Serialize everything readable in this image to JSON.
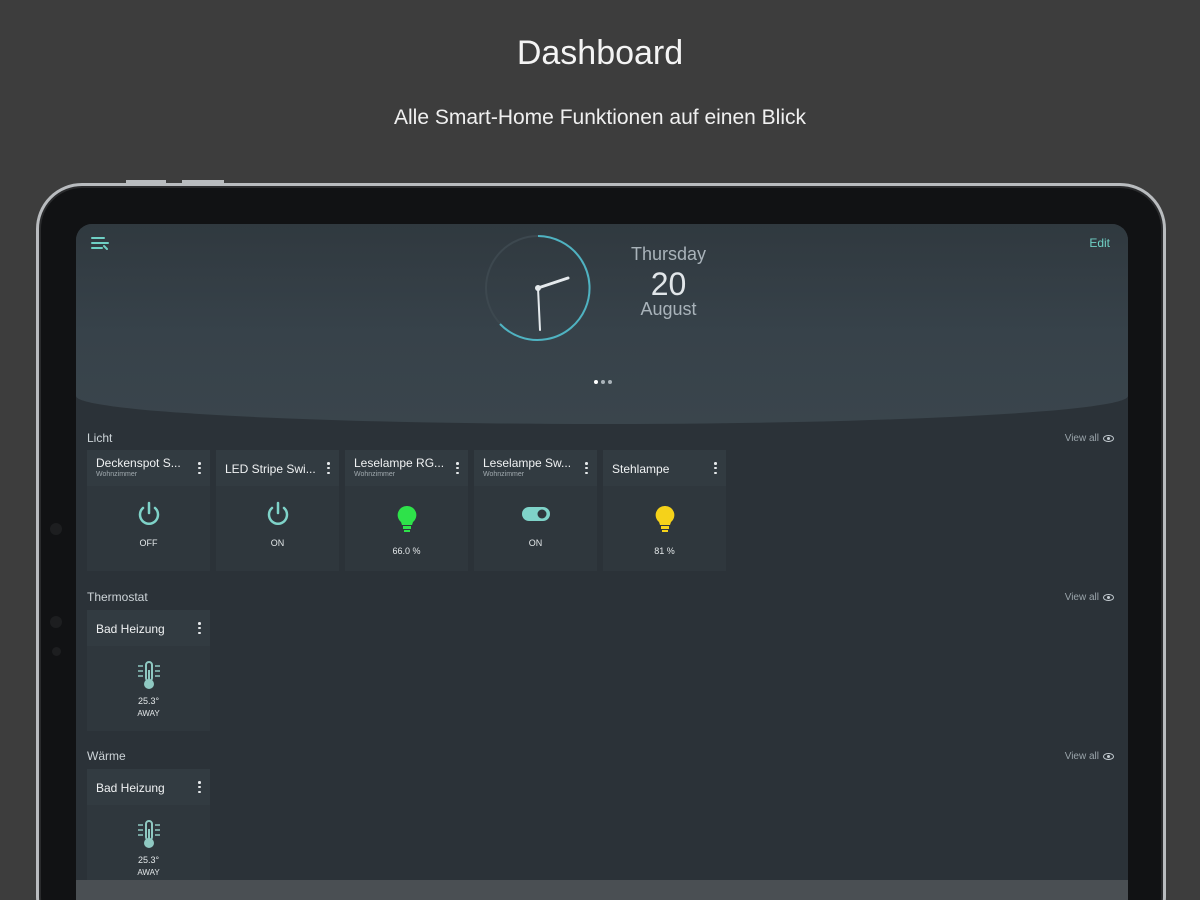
{
  "promo": {
    "title": "Dashboard",
    "subtitle": "Alle Smart-Home Funktionen auf einen Blick"
  },
  "header": {
    "edit_label": "Edit",
    "day": "Thursday",
    "date": "20",
    "month": "August"
  },
  "sections": [
    {
      "title": "Licht",
      "view_all": "View all",
      "cards": [
        {
          "name": "Deckenspot S...",
          "room": "Wohnzimmer",
          "value": "OFF",
          "icon": "power-icon",
          "color": "#7fd3c9"
        },
        {
          "name": "LED Stripe Swi...",
          "room": "",
          "value": "ON",
          "icon": "power-icon",
          "color": "#7fd3c9"
        },
        {
          "name": "Leselampe RG...",
          "room": "Wohnzimmer",
          "value": "66.0 %",
          "icon": "bulb-icon",
          "color": "#2ee24a"
        },
        {
          "name": "Leselampe Sw...",
          "room": "Wohnzimmer",
          "value": "ON",
          "icon": "toggle-icon",
          "color": "#7fd3c9"
        },
        {
          "name": "Stehlampe",
          "room": "",
          "value": "81 %",
          "icon": "bulb-icon",
          "color": "#f5d21a"
        }
      ]
    },
    {
      "title": "Thermostat",
      "view_all": "View all",
      "cards": [
        {
          "name": "Bad Heizung",
          "room": "",
          "value": "25.3°",
          "mode": "AWAY",
          "icon": "thermometer-icon",
          "color": "#8fc9c2"
        }
      ]
    },
    {
      "title": "Wärme",
      "view_all": "View all",
      "cards": [
        {
          "name": "Bad Heizung",
          "room": "",
          "value": "25.3°",
          "mode": "AWAY",
          "icon": "thermometer-icon",
          "color": "#8fc9c2"
        }
      ]
    }
  ]
}
